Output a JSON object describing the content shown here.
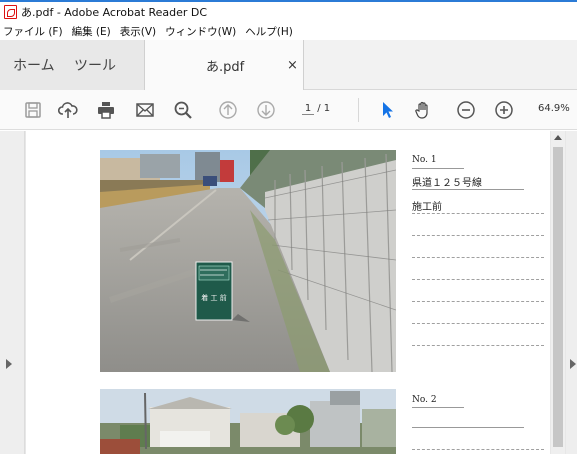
{
  "window": {
    "title": "あ.pdf - Adobe Acrobat Reader DC"
  },
  "menu": [
    "ファイル (F)",
    "編集 (E)",
    "表示(V)",
    "ウィンドウ(W)",
    "ヘルプ(H)"
  ],
  "tabs": {
    "home": "ホーム",
    "tools": "ツール",
    "document": "あ.pdf",
    "close": "×"
  },
  "toolbar": {
    "current_page": "1",
    "page_separator": "/",
    "total_pages": "1",
    "zoom": "64.9%",
    "icons": [
      "save-icon",
      "upload-icon",
      "print-icon",
      "mail-icon",
      "zoom-search-icon",
      "page-up-icon",
      "page-down-icon",
      "select-pointer-icon",
      "hand-icon",
      "zoom-out-icon",
      "zoom-in-icon"
    ],
    "accent_color": "#1473e6"
  },
  "document": {
    "entries": [
      {
        "number": "No. 1",
        "location": "県道１２５号線",
        "status": "施工前",
        "sign_text": "着 工 前"
      },
      {
        "number": "No. 2",
        "location": "",
        "status": ""
      }
    ]
  }
}
